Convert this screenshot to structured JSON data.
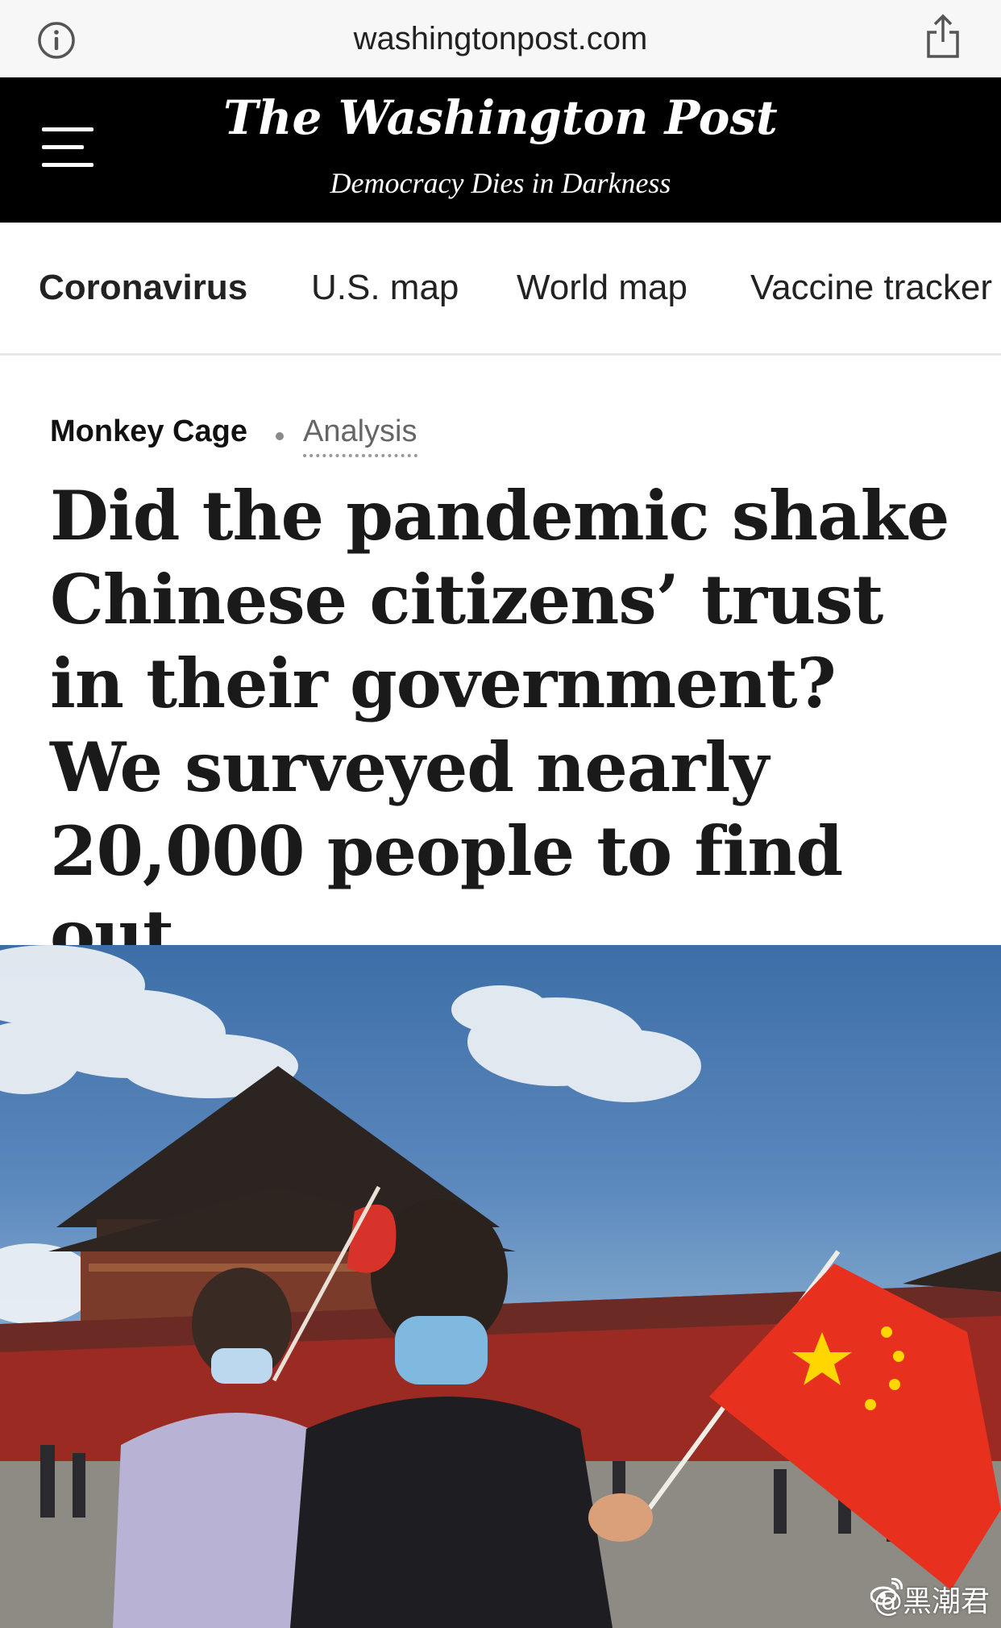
{
  "browser": {
    "domain": "washingtonpost.com",
    "icons": {
      "info": "info-circle-icon",
      "share": "share-icon"
    }
  },
  "masthead": {
    "logo": "The Washington Post",
    "tagline": "Democracy Dies in Darkness",
    "menu_icon": "hamburger-menu-icon"
  },
  "nav": {
    "items": [
      {
        "label": "Coronavirus",
        "active": true
      },
      {
        "label": "U.S. map",
        "active": false
      },
      {
        "label": "World map",
        "active": false
      },
      {
        "label": "Vaccine tracker",
        "active": false
      }
    ]
  },
  "article": {
    "section": "Monkey Cage",
    "label": "Analysis",
    "headline": "Did the pandemic shake Chinese citizens’ trust in their government? We surveyed nearly 20,000 people to find out."
  },
  "photo": {
    "watermark": "@黑潮君"
  },
  "colors": {
    "masthead_bg": "#000000",
    "flag_red": "#e8301e",
    "flag_star": "#ffd600",
    "sky": "#4a7bb3"
  }
}
